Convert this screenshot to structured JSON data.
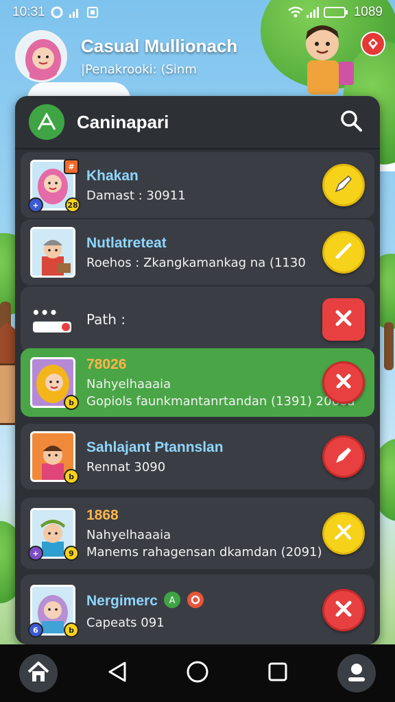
{
  "status": {
    "time": "10:31",
    "battery": "1089"
  },
  "profile": {
    "name": "Casual Mullionach",
    "subtitle": "|Penakrooki: (Sinm"
  },
  "panel": {
    "title": "Caninapari"
  },
  "rows": [
    {
      "title": "Khakan",
      "sub": "Damast : 30911",
      "sub2": "",
      "action": "yellow",
      "action_icon": "pen-icon",
      "badge": "28"
    },
    {
      "title": "Nutlatreteat",
      "sub": "Roehos : Zkangkamankag na (1130",
      "sub2": "",
      "action": "yellow",
      "action_icon": "check-icon",
      "badge": ""
    },
    {
      "title": "",
      "sub": "Path :",
      "sub2": "",
      "action": "red-square",
      "action_icon": "close-icon",
      "badge": ""
    },
    {
      "title": "78026",
      "sub": "Nahyelhaaaia",
      "sub2": "Gopiols faunkmantanrtandan (1391) 2060a",
      "action": "red",
      "action_icon": "close-icon",
      "badge": ""
    },
    {
      "title": "Sahlajant Ptannslan",
      "sub": "Rennat 3090",
      "sub2": "",
      "action": "red",
      "action_icon": "pen-icon",
      "badge": ""
    },
    {
      "title": "1868",
      "sub": "Nahyelhaaaia",
      "sub2": "Manems rahagensan dkamdan (2091)",
      "action": "yellow",
      "action_icon": "tools-icon",
      "badge": ""
    },
    {
      "title": "Nergimerc",
      "sub": "Capeats 091",
      "sub2": "",
      "action": "red",
      "action_icon": "close-icon",
      "badge": ""
    }
  ],
  "colors": {
    "panel": "#2d3136",
    "row": "#3a3e44",
    "active_row": "#4aa547",
    "accent_blue": "#8fd6ff",
    "yellow": "#f7d21a",
    "red": "#e84040"
  },
  "nav": {
    "items": [
      "home-icon",
      "back-icon",
      "circle-home-icon",
      "recent-apps-icon",
      "profile-icon"
    ]
  }
}
